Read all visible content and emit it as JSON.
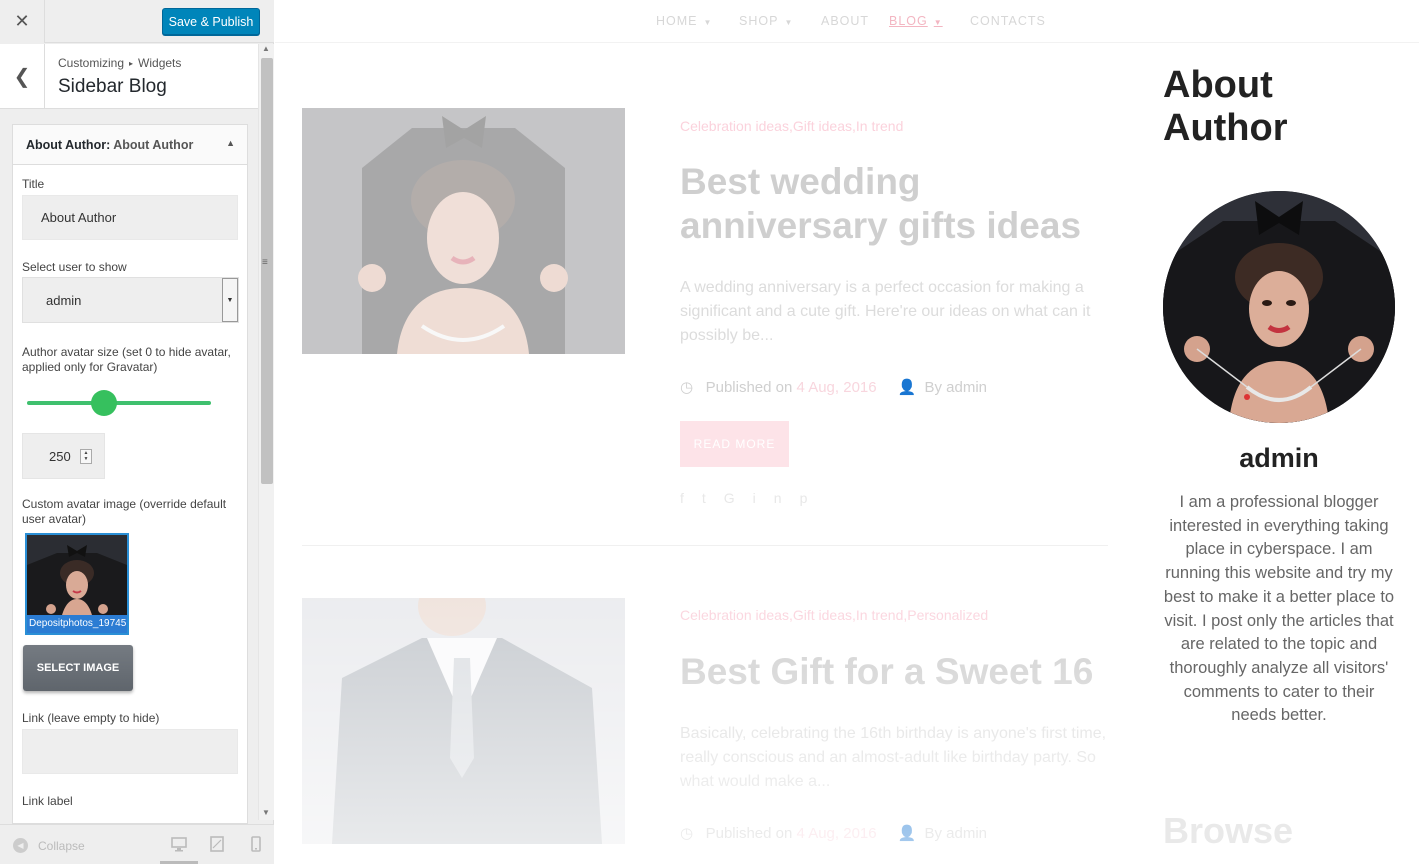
{
  "customizer": {
    "close_icon": "close-icon",
    "save_label": "Save & Publish",
    "breadcrumb_root": "Customizing",
    "breadcrumb_current": "Widgets",
    "section_title": "Sidebar Blog",
    "widget": {
      "type": "About Author",
      "separator": ": ",
      "instance": "About Author",
      "title_label": "Title",
      "title_value": "About Author",
      "user_label": "Select user to show",
      "user_value": "admin",
      "avatar_size_label": "Author avatar size (set 0 to hide avatar, applied only for Gravatar)",
      "avatar_size_value": "250",
      "avatar_size_slider_fraction": 0.42,
      "custom_avatar_label": "Custom avatar image (override default user avatar)",
      "avatar_filename": "Depositphotos_19745",
      "select_image_label": "SELECT IMAGE",
      "link_label": "Link (leave empty to hide)",
      "link_value": "",
      "link_text_label": "Link label"
    },
    "footer": {
      "collapse_label": "Collapse",
      "devices": [
        "desktop-icon",
        "tablet-icon",
        "mobile-icon"
      ]
    }
  },
  "preview": {
    "nav": [
      "HOME",
      "SHOP",
      "ABOUT",
      "BLOG",
      "CONTACTS"
    ],
    "posts": [
      {
        "categories": "Celebration ideas,Gift ideas,In trend",
        "title": "Best wedding anniversary gifts ideas",
        "excerpt": "A wedding anniversary is a perfect occasion for making a significant and a cute gift. Here're our ideas on what can it possibly be...",
        "published_prefix": "Published on ",
        "date": "4 Aug, 2016",
        "author": "By admin",
        "read_more": "READ MORE"
      },
      {
        "categories": "Celebration ideas,Gift ideas,In trend,Personalized",
        "title": "Best Gift for a Sweet 16",
        "excerpt": "Basically, celebrating the 16th birthday is anyone's first time, really conscious and an almost-adult like birthday party. So what would make a...",
        "published_prefix": "Published on ",
        "date": "4 Aug, 2016",
        "author": "By admin"
      }
    ],
    "sidebar": {
      "title": "About Author",
      "author_name": "admin",
      "bio": "I am a professional blogger interested in everything taking place in cyberspace. I am running this website and try my best to make it a better place to visit. I post only the articles that are related to the topic and thoroughly analyze all visitors' comments to cater to their needs better.",
      "next_widget_title": "Browse"
    }
  }
}
